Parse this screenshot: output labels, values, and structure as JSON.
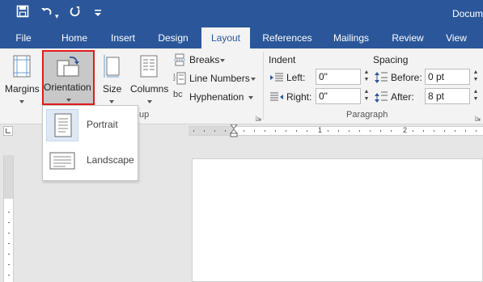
{
  "titlebar": {
    "doc_title": "Docum",
    "qa_icons": [
      "save-icon",
      "undo-icon",
      "redo-icon",
      "customize-icon"
    ]
  },
  "tabs": [
    {
      "label": "File",
      "active": false
    },
    {
      "label": "Home",
      "active": false
    },
    {
      "label": "Insert",
      "active": false
    },
    {
      "label": "Design",
      "active": false
    },
    {
      "label": "Layout",
      "active": true
    },
    {
      "label": "References",
      "active": false
    },
    {
      "label": "Mailings",
      "active": false
    },
    {
      "label": "Review",
      "active": false
    },
    {
      "label": "View",
      "active": false
    }
  ],
  "page_setup": {
    "margins": "Margins",
    "orientation": "Orientation",
    "size": "Size",
    "columns": "Columns",
    "breaks": "Breaks",
    "line_numbers": "Line Numbers",
    "hyphenation": "Hyphenation",
    "group_label_partial": "up"
  },
  "paragraph": {
    "indent_header": "Indent",
    "spacing_header": "Spacing",
    "left_label": "Left:",
    "left_value": "0\"",
    "right_label": "Right:",
    "right_value": "0\"",
    "before_label": "Before:",
    "before_value": "0 pt",
    "after_label": "After:",
    "after_value": "8 pt",
    "group_label": "Paragraph"
  },
  "orientation_menu": {
    "items": [
      {
        "label": "Portrait",
        "selected": true
      },
      {
        "label": "Landscape",
        "selected": false
      }
    ]
  },
  "ruler": {
    "numbers": [
      "1",
      "2"
    ]
  },
  "colors": {
    "accent": "#2b579a",
    "highlight_border": "#e21a1a",
    "ribbon_bg": "#f3f3f3",
    "workspace_bg": "#e6e6e6"
  }
}
